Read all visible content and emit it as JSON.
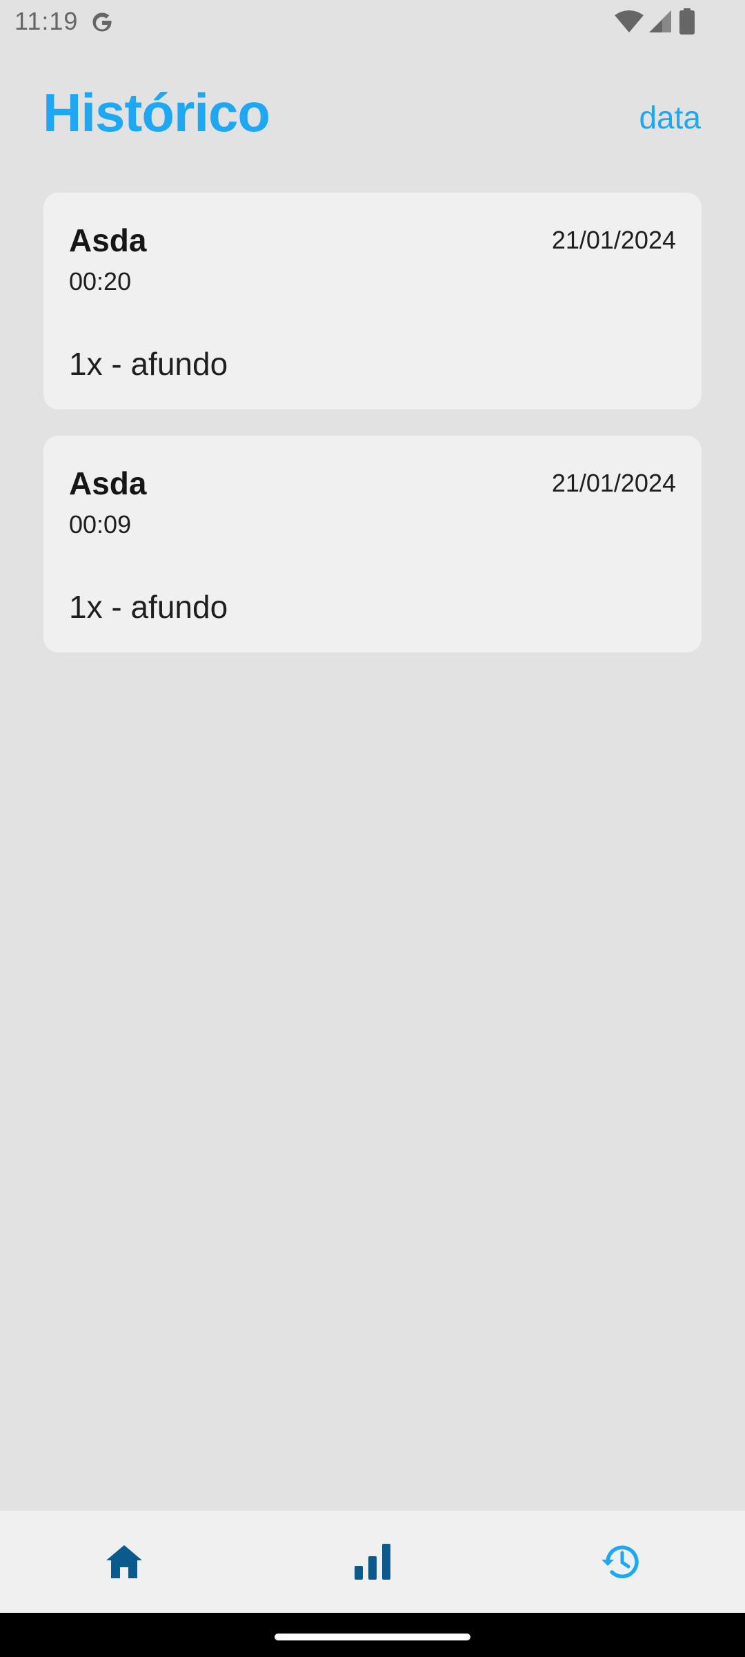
{
  "status_bar": {
    "time": "11:19"
  },
  "header": {
    "title": "Histórico",
    "sort_label": "data"
  },
  "history": [
    {
      "title": "Asda",
      "date": "21/01/2024",
      "duration": "00:20",
      "exercise": "1x - afundo"
    },
    {
      "title": "Asda",
      "date": "21/01/2024",
      "duration": "00:09",
      "exercise": "1x - afundo"
    }
  ],
  "nav": {
    "items": [
      {
        "icon": "home-icon",
        "active": false
      },
      {
        "icon": "bar-chart-icon",
        "active": false
      },
      {
        "icon": "history-icon",
        "active": true
      }
    ]
  },
  "colors": {
    "accent": "#1da8f6",
    "nav_inactive": "#0b5a8c",
    "background": "#e2e2e2",
    "card": "#f0f0f0"
  }
}
